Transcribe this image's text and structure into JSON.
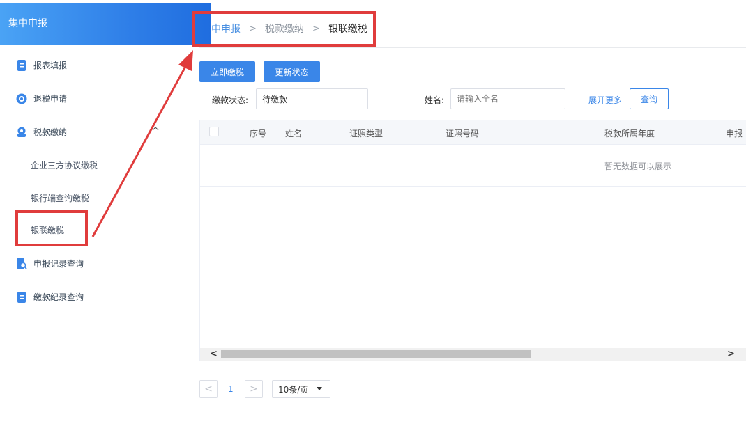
{
  "sidebar": {
    "header_title": "集中申报",
    "items": [
      {
        "label": "报表填报",
        "icon": "document-icon"
      },
      {
        "label": "退税申请",
        "icon": "refund-icon"
      },
      {
        "label": "税款缴纳",
        "icon": "payment-icon"
      },
      {
        "label": "申报记录查询",
        "icon": "record-search-icon"
      },
      {
        "label": "缴款纪录查询",
        "icon": "document-icon"
      }
    ],
    "sub_items": [
      {
        "label": "企业三方协议缴税"
      },
      {
        "label": "银行端查询缴税"
      },
      {
        "label": "银联缴税"
      }
    ]
  },
  "breadcrumb": {
    "items": [
      "中申报",
      "税款缴纳",
      "银联缴税"
    ],
    "separator": ">"
  },
  "toolbar": {
    "pay_now_label": "立即缴税",
    "update_status_label": "更新状态"
  },
  "filters": {
    "status_label": "缴款状态:",
    "status_value": "待缴款",
    "name_label": "姓名:",
    "name_placeholder": "请输入全名",
    "expand_label": "展开更多",
    "query_label": "查询"
  },
  "table": {
    "columns": [
      "序号",
      "姓名",
      "证照类型",
      "证照号码",
      "税款所属年度",
      "申报"
    ],
    "empty_text": "暂无数据可以展示"
  },
  "pagination": {
    "current_page": "1",
    "page_size": "10条/页",
    "prev": "<",
    "next": ">"
  },
  "colors": {
    "accent": "#3a86e8",
    "highlight": "#e03c3c"
  }
}
